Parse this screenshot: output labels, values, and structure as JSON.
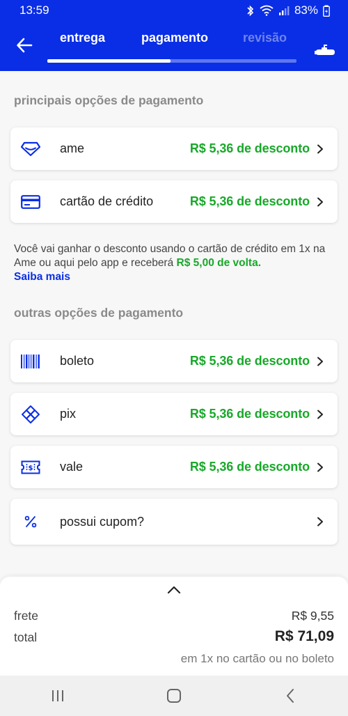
{
  "status": {
    "time": "13:59",
    "battery": "83%"
  },
  "header": {
    "tabs": [
      {
        "label": "entrega"
      },
      {
        "label": "pagamento"
      },
      {
        "label": "revisão"
      }
    ],
    "progress_fraction": 0.495
  },
  "main_section": {
    "title": "principais opções de pagamento",
    "items": [
      {
        "label": "ame",
        "discount": "R$ 5,36 de desconto",
        "icon": "ame-diamond-icon"
      },
      {
        "label": "cartão de crédito",
        "discount": "R$ 5,36 de desconto",
        "icon": "credit-card-icon"
      }
    ]
  },
  "info": {
    "text": "Você vai ganhar o desconto usando o cartão de crédito em 1x na Ame ou aqui pelo app e receberá ",
    "highlight": "R$ 5,00 de volta.",
    "link": "Saiba mais"
  },
  "other_section": {
    "title": "outras opções de pagamento",
    "items": [
      {
        "label": "boleto",
        "discount": "R$ 5,36 de desconto",
        "icon": "barcode-icon"
      },
      {
        "label": "pix",
        "discount": "R$ 5,36 de desconto",
        "icon": "pix-icon"
      },
      {
        "label": "vale",
        "discount": "R$ 5,36 de desconto",
        "icon": "voucher-icon"
      },
      {
        "label": "possui cupom?",
        "icon": "percent-icon"
      }
    ]
  },
  "summary": {
    "frete_label": "frete",
    "frete_value": "R$ 9,55",
    "total_label": "total",
    "total_value": "R$ 71,09",
    "note": "em 1x no cartão ou no boleto"
  },
  "colors": {
    "brand": "#0a2ee5",
    "discount": "#18a82a"
  }
}
